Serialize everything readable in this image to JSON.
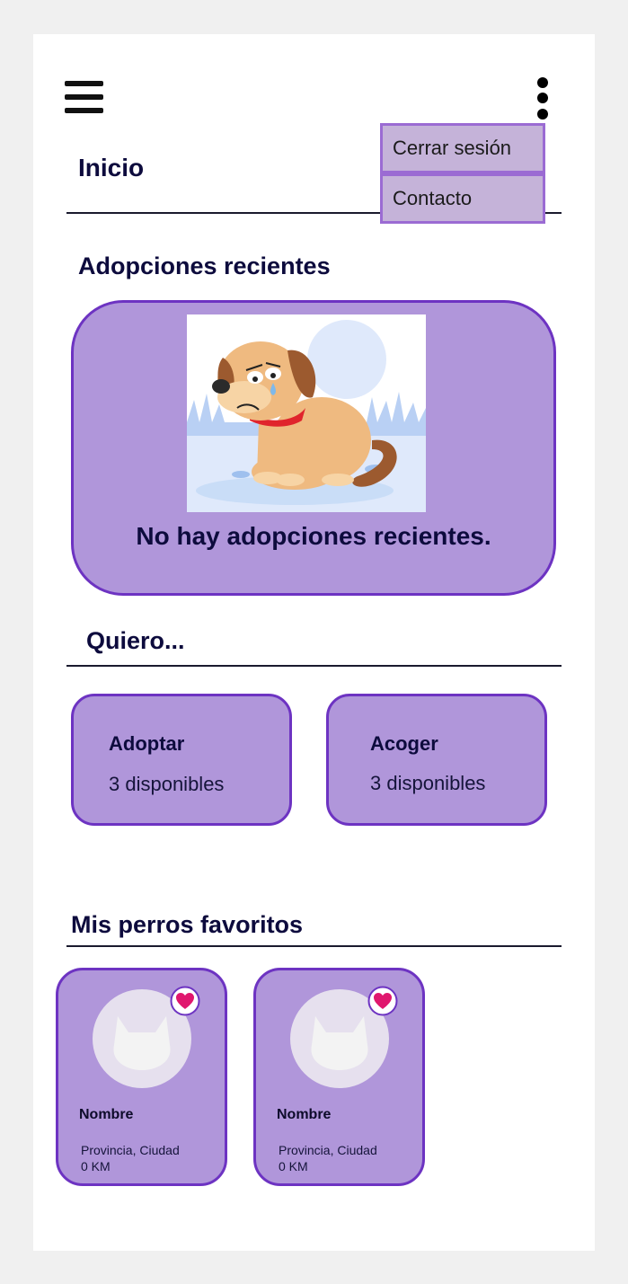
{
  "header": {
    "menu_icon": "hamburger-menu-icon",
    "more_icon": "more-vertical-icon",
    "title": "Inicio"
  },
  "dropdown_menu": {
    "items": [
      {
        "label": "Cerrar sesión"
      },
      {
        "label": "Contacto"
      }
    ]
  },
  "recent_adoptions": {
    "title": "Adopciones recientes",
    "image_icon": "sad-dog-illustration",
    "empty_message": "No hay adopciones recientes."
  },
  "want": {
    "title": "Quiero...",
    "options": [
      {
        "label": "Adoptar",
        "count_text": "3 disponibles"
      },
      {
        "label": "Acoger",
        "count_text": "3 disponibles"
      }
    ]
  },
  "favorites": {
    "title": "Mis perros favoritos",
    "items": [
      {
        "name": "Nombre",
        "location": "Provincia, Ciudad",
        "distance": "0 KM",
        "favorite": true
      },
      {
        "name": "Nombre",
        "location": "Provincia, Ciudad",
        "distance": "0 KM",
        "favorite": true
      }
    ]
  },
  "colors": {
    "card_bg": "#b096da",
    "card_border": "#6d33c2",
    "menu_bg": "#c5b3d9",
    "heart": "#e0176e",
    "text": "#0d0b3d"
  }
}
